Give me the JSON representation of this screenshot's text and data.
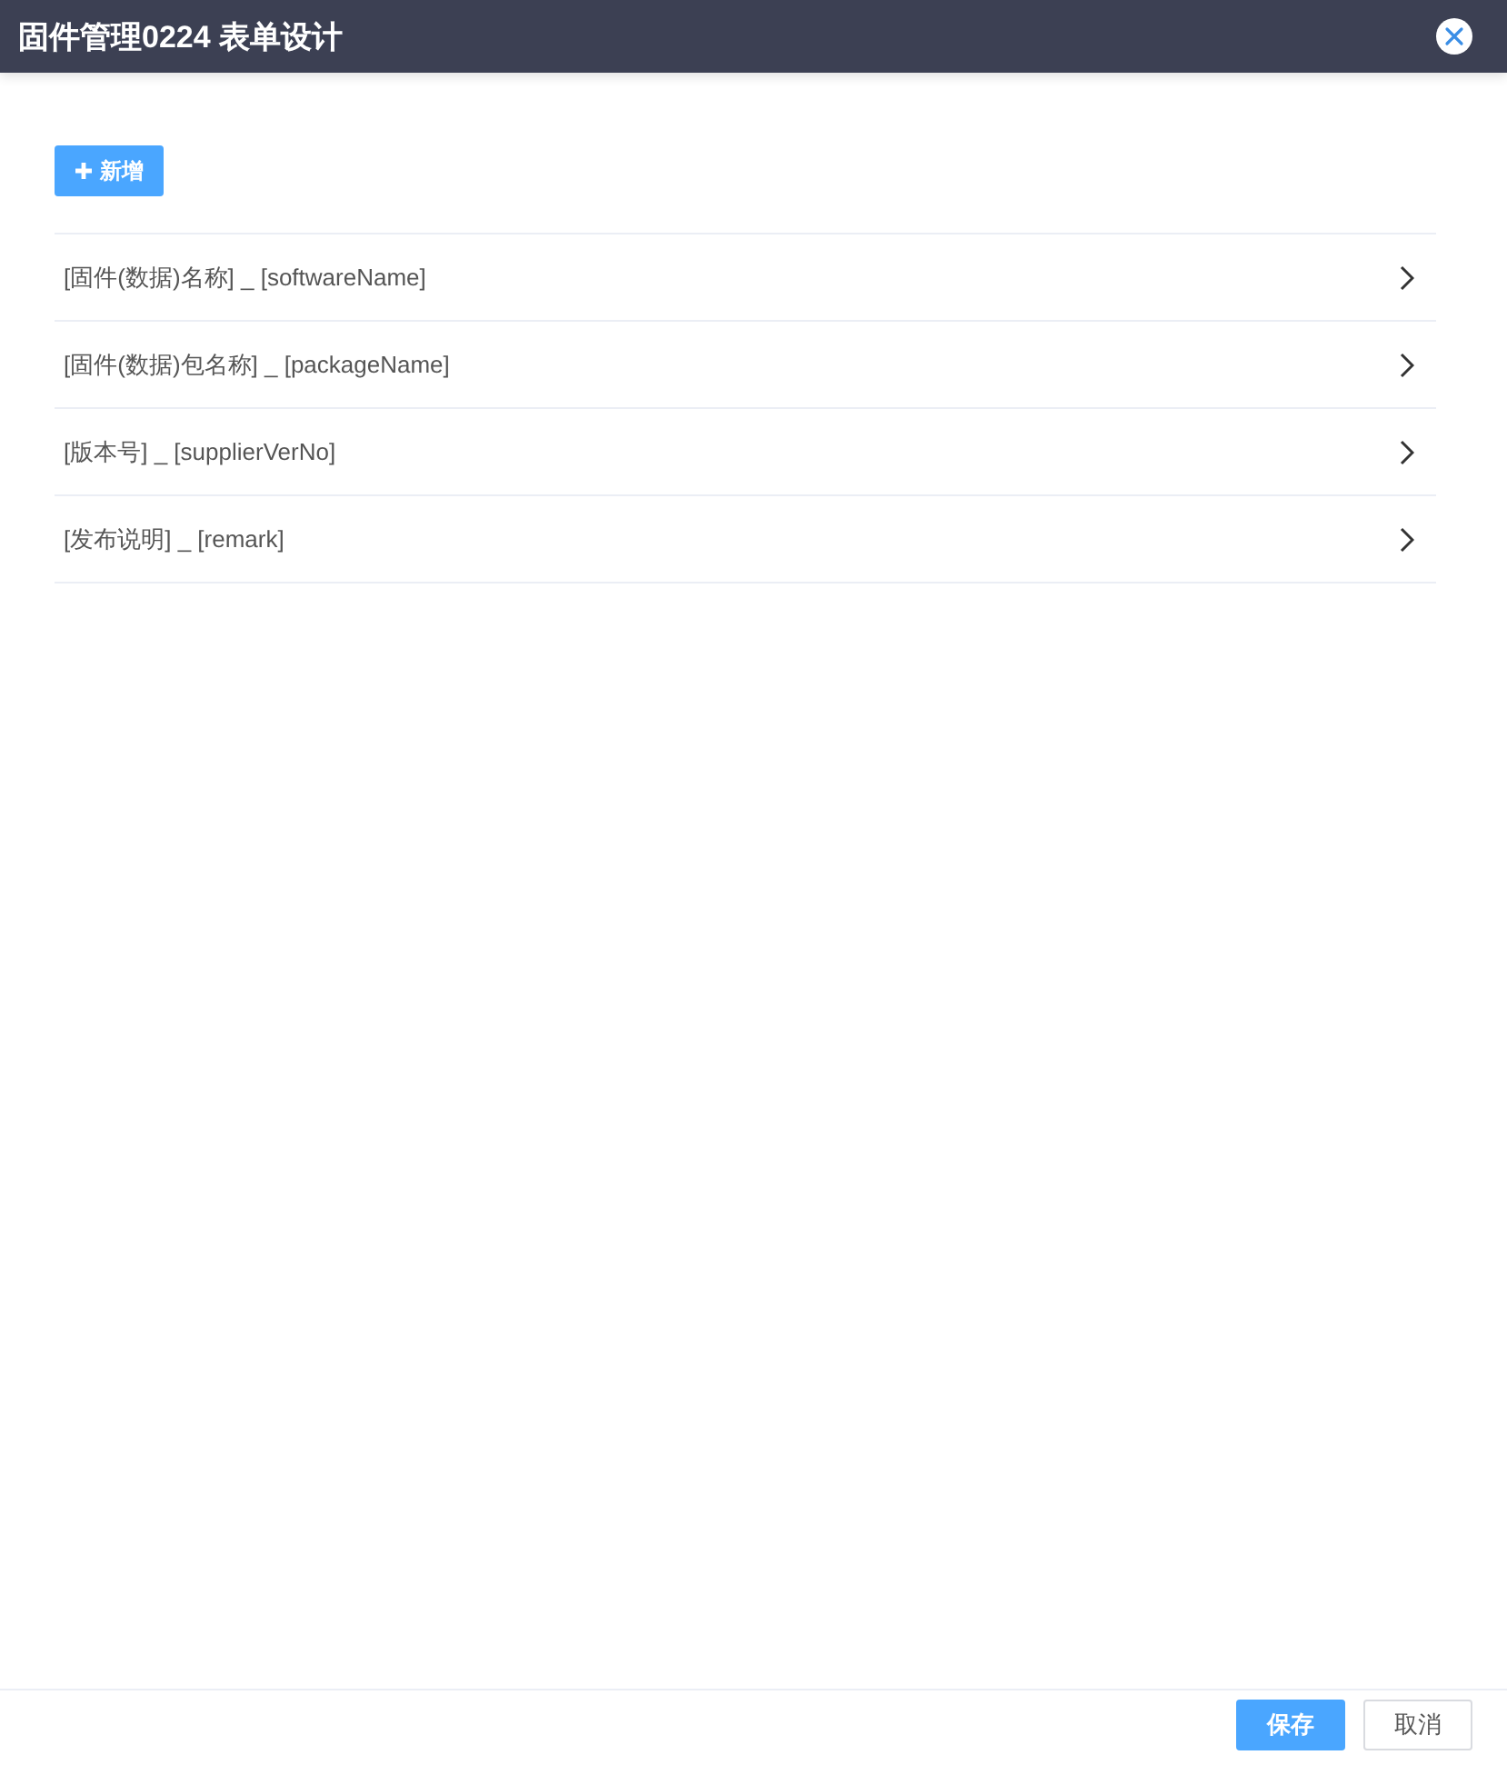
{
  "window": {
    "title": "固件管理0224 表单设计"
  },
  "toolbar": {
    "add_button": "新增"
  },
  "fields": [
    {
      "label": "[固件(数据)名称] _ [softwareName]"
    },
    {
      "label": "[固件(数据)包名称] _ [packageName]"
    },
    {
      "label": "[版本号] _ [supplierVerNo]"
    },
    {
      "label": "[发布说明] _ [remark]"
    }
  ],
  "buttons": [
    {
      "label": "保存",
      "kind": "primary"
    },
    {
      "label": "取消",
      "kind": "default"
    }
  ]
}
